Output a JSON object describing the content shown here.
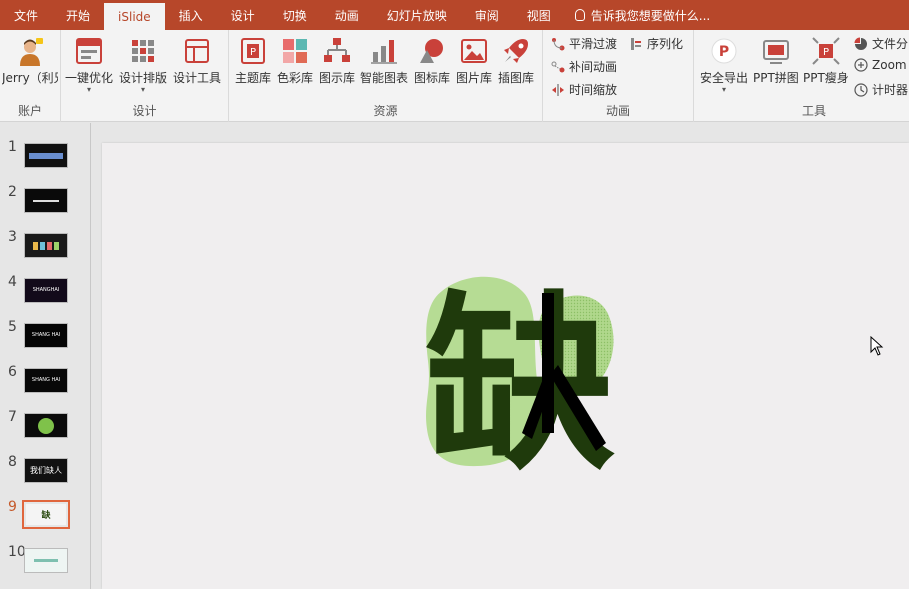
{
  "menu": {
    "tabs": [
      "文件",
      "开始",
      "iSlide",
      "插入",
      "设计",
      "切换",
      "动画",
      "幻灯片放映",
      "审阅",
      "视图"
    ],
    "active_index": 2,
    "tell_me": "告诉我您想要做什么..."
  },
  "ribbon": {
    "account": {
      "user_label": "Jerry（利兄…",
      "group_label": "账户"
    },
    "design": {
      "one_click": "一键优化",
      "layout": "设计排版",
      "tools": "设计工具",
      "group_label": "设计"
    },
    "resources": {
      "theme": "主题库",
      "color": "色彩库",
      "diagram": "图示库",
      "smart_chart": "智能图表",
      "icon": "图标库",
      "picture": "图片库",
      "illustration": "插图库",
      "group_label": "资源"
    },
    "animation": {
      "smooth": "平滑过渡",
      "sequence": "序列化",
      "tween": "补间动画",
      "time_scale": "时间缩放",
      "group_label": "动画"
    },
    "tools": {
      "safe_export": "安全导出",
      "ppt_merge": "PPT拼图",
      "ppt_slim": "PPT瘦身",
      "file_split": "文件分",
      "zoom": "Zoom",
      "timer": "计时器",
      "group_label": "工具"
    }
  },
  "slides": {
    "numbers": [
      "1",
      "2",
      "3",
      "4",
      "5",
      "6",
      "7",
      "8",
      "9",
      "10"
    ],
    "thumb_texts": [
      "",
      "",
      "",
      "SHANGHAI",
      "SHANG HAI",
      "SHANG HAI",
      "",
      "我们缺人",
      "缺",
      ""
    ],
    "active_index": 8
  },
  "canvas": {
    "main_character": "缺"
  },
  "colors": {
    "accent": "#b7472a",
    "blob_light": "#b6dc94",
    "blob_dark": "#9ccb7a",
    "glyph_dark": "#1f3a0c",
    "glyph_black": "#000000"
  }
}
